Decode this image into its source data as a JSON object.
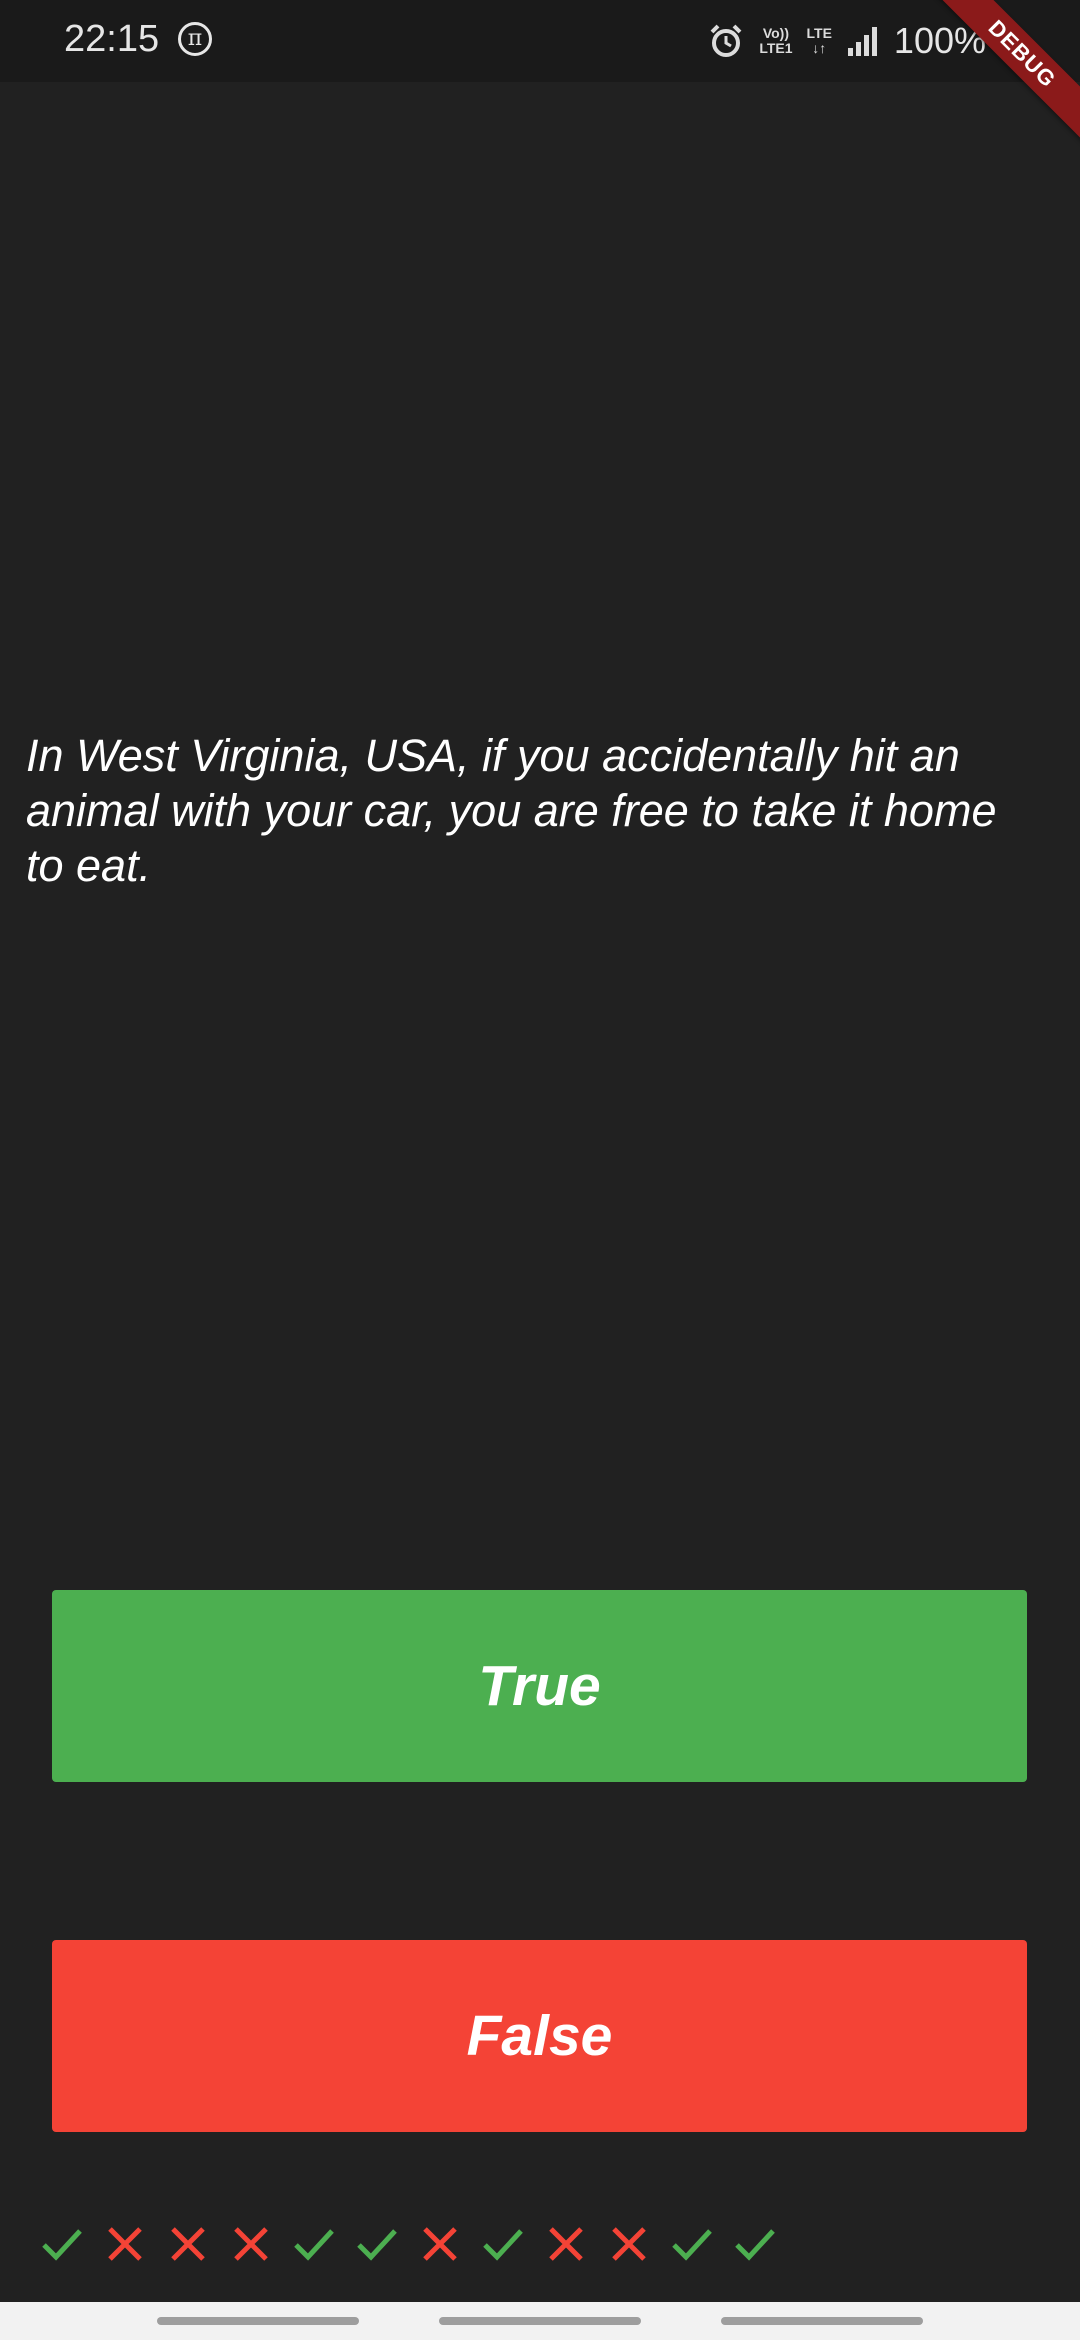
{
  "status_bar": {
    "time": "22:15",
    "battery": "100%",
    "network_label_top": "Vo)) LTE",
    "network_label_bottom": "LTE1"
  },
  "debug_banner": "DEBUG",
  "quiz": {
    "question": "In West Virginia, USA, if you accidentally hit an animal with your car, you are free to take it home to eat.",
    "true_label": "True",
    "false_label": "False"
  },
  "colors": {
    "background": "#212121",
    "true_button": "#4caf50",
    "false_button": "#f44336",
    "check": "#4caf50",
    "cross": "#f44336",
    "debug": "#8b1a1a"
  },
  "score_keeper": [
    "check",
    "cross",
    "cross",
    "cross",
    "check",
    "check",
    "cross",
    "check",
    "cross",
    "cross",
    "check",
    "check"
  ],
  "icons": {
    "pi": "pi-icon",
    "alarm": "alarm-icon",
    "signal": "signal-icon",
    "battery": "battery-icon",
    "check": "check-icon",
    "cross": "close-icon"
  }
}
